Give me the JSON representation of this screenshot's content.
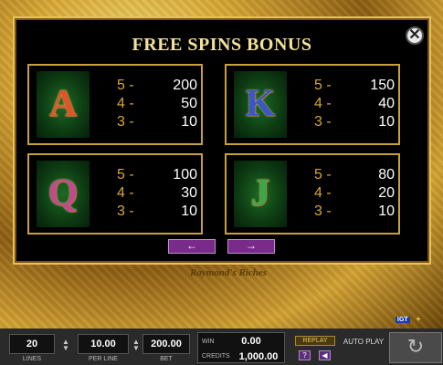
{
  "header": {
    "title": "FREE SPINS BONUS"
  },
  "cards": [
    {
      "symbol": "A",
      "color": "#e0542a",
      "pays": [
        {
          "k": "5 -",
          "v": "200"
        },
        {
          "k": "4 -",
          "v": "50"
        },
        {
          "k": "3 -",
          "v": "10"
        }
      ]
    },
    {
      "symbol": "K",
      "color": "#3a56c8",
      "pays": [
        {
          "k": "5 -",
          "v": "150"
        },
        {
          "k": "4 -",
          "v": "40"
        },
        {
          "k": "3 -",
          "v": "10"
        }
      ]
    },
    {
      "symbol": "Q",
      "color": "#c04a8c",
      "pays": [
        {
          "k": "5 -",
          "v": "100"
        },
        {
          "k": "4 -",
          "v": "30"
        },
        {
          "k": "3 -",
          "v": "10"
        }
      ]
    },
    {
      "symbol": "J",
      "color": "#3aa84a",
      "pays": [
        {
          "k": "5 -",
          "v": "80"
        },
        {
          "k": "4 -",
          "v": "20"
        },
        {
          "k": "3 -",
          "v": "10"
        }
      ]
    }
  ],
  "nav": {
    "prev": "←",
    "next": "→"
  },
  "logo": {
    "text": "Raymond's Riches"
  },
  "controls": {
    "lines": {
      "value": "20",
      "label": "LINES"
    },
    "per_line": {
      "value": "10.00",
      "label": "PER LINE"
    },
    "bet": {
      "value": "200.00",
      "label": "BET"
    },
    "win": {
      "label": "WIN",
      "value": "0.00"
    },
    "credits": {
      "label": "CREDITS",
      "value": "1,000.00"
    },
    "replay": "REPLAY",
    "help": "?",
    "sound_icon": "speaker-icon",
    "auto": "AUTO PLAY",
    "spin_icon": "refresh-icon",
    "brand": "IGT"
  }
}
